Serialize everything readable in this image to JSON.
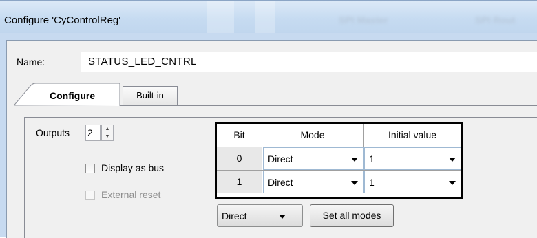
{
  "window": {
    "title": "Configure 'CyControlReg'",
    "ghost_texts": [
      "SPI Master",
      "SPI Rout"
    ]
  },
  "name_field": {
    "label": "Name:",
    "value": "STATUS_LED_CNTRL"
  },
  "tabs": [
    {
      "label": "Configure",
      "active": true
    },
    {
      "label": "Built-in",
      "active": false
    }
  ],
  "outputs": {
    "label": "Outputs",
    "value": "2"
  },
  "checkboxes": [
    {
      "label": "Display as bus",
      "checked": false,
      "enabled": true
    },
    {
      "label": "External reset",
      "checked": false,
      "enabled": false
    }
  ],
  "grid": {
    "headers": [
      "Bit",
      "Mode",
      "Initial value"
    ],
    "rows": [
      {
        "bit": "0",
        "mode": "Direct",
        "initial": "1"
      },
      {
        "bit": "1",
        "mode": "Direct",
        "initial": "1"
      }
    ]
  },
  "mode_select": {
    "value": "Direct"
  },
  "set_all_button": {
    "label": "Set all modes"
  },
  "colors": {
    "titlebar": "#c6dbf1",
    "client": "#f0f0f0",
    "accent_border": "#9fb9d3"
  },
  "icons": [
    "spinner-up-icon",
    "spinner-down-icon",
    "dropdown-arrow-icon"
  ]
}
